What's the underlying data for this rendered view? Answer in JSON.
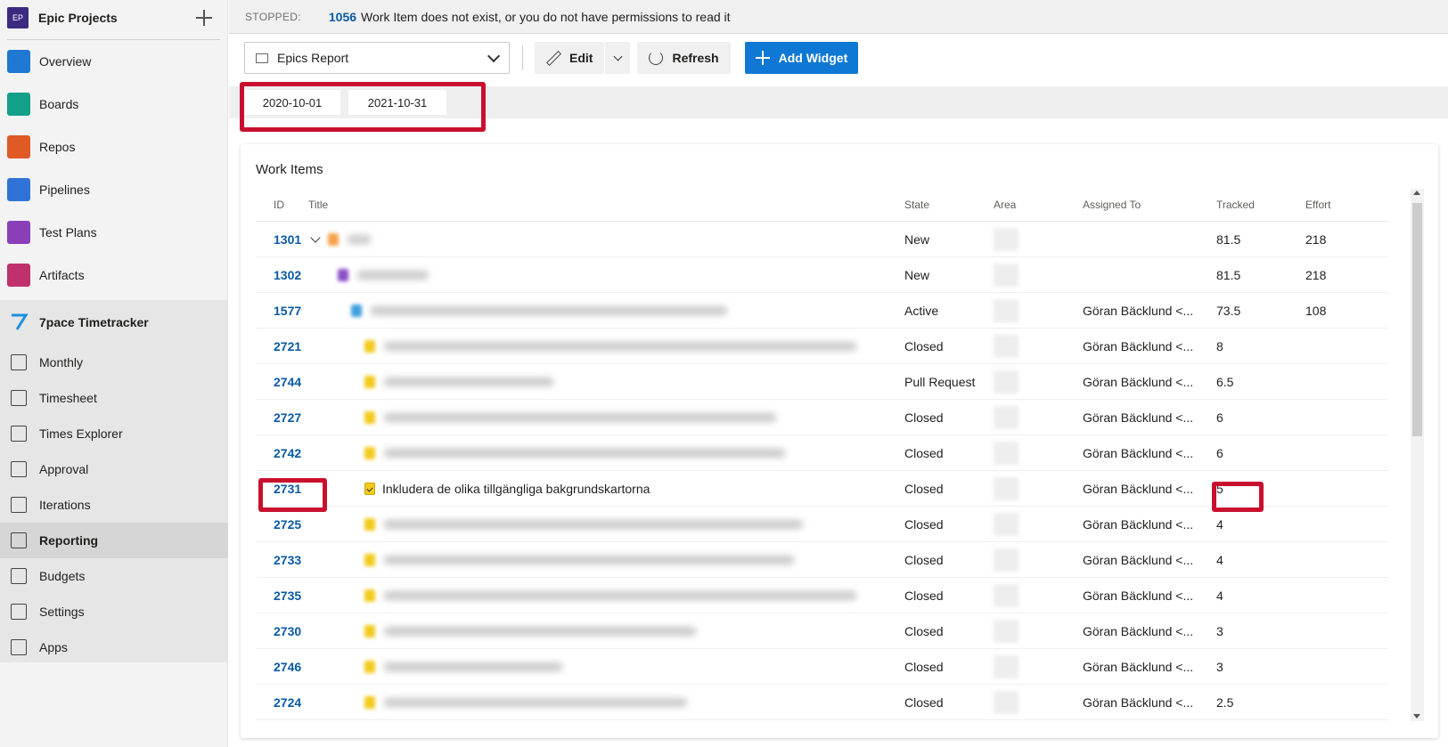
{
  "project": {
    "avatar": "EP",
    "name": "Epic Projects"
  },
  "nav": [
    {
      "label": "Overview",
      "icon": "overview-icon",
      "color": "#1f78d1"
    },
    {
      "label": "Boards",
      "icon": "boards-icon",
      "color": "#13a089"
    },
    {
      "label": "Repos",
      "icon": "repos-icon",
      "color": "#e05a26"
    },
    {
      "label": "Pipelines",
      "icon": "pipelines-icon",
      "color": "#2f73d6"
    },
    {
      "label": "Test Plans",
      "icon": "test-plans-icon",
      "color": "#8a3fb8"
    },
    {
      "label": "Artifacts",
      "icon": "artifacts-icon",
      "color": "#c0306c"
    }
  ],
  "tracker": {
    "title": "7pace Timetracker",
    "items": [
      {
        "label": "Monthly",
        "icon": "calendar-icon"
      },
      {
        "label": "Timesheet",
        "icon": "timesheet-icon"
      },
      {
        "label": "Times Explorer",
        "icon": "explorer-icon"
      },
      {
        "label": "Approval",
        "icon": "approval-icon"
      },
      {
        "label": "Iterations",
        "icon": "iterations-icon"
      },
      {
        "label": "Reporting",
        "icon": "reporting-icon",
        "active": true
      },
      {
        "label": "Budgets",
        "icon": "budgets-icon"
      },
      {
        "label": "Settings",
        "icon": "settings-icon"
      },
      {
        "label": "Apps",
        "icon": "apps-icon"
      }
    ]
  },
  "status": {
    "label": "STOPPED:",
    "id": "1056",
    "message": "Work Item does not exist, or you do not have permissions to read it"
  },
  "toolbar": {
    "dashboard": "Epics Report",
    "edit": "Edit",
    "refresh": "Refresh",
    "add_widget": "Add Widget"
  },
  "filters": {
    "start": "2020-10-01",
    "end": "2021-10-31"
  },
  "widget": {
    "title": "Work Items",
    "columns": {
      "id": "ID",
      "title": "Title",
      "state": "State",
      "area": "Area",
      "assigned": "Assigned To",
      "tracked": "Tracked",
      "effort": "Effort"
    },
    "rows": [
      {
        "id": "1301",
        "state": "New",
        "assigned": "",
        "tracked": "81.5",
        "effort": "218",
        "indent": 0,
        "expand": true,
        "icon_color": "#f7a24b",
        "title": ""
      },
      {
        "id": "1302",
        "state": "New",
        "assigned": "",
        "tracked": "81.5",
        "effort": "218",
        "indent": 1,
        "icon_color": "#8a4fc7",
        "title": ""
      },
      {
        "id": "1577",
        "state": "Active",
        "assigned": "Göran Bäcklund <...",
        "tracked": "73.5",
        "effort": "108",
        "indent": 2,
        "icon_color": "#3e9fe0",
        "title": ""
      },
      {
        "id": "2721",
        "state": "Closed",
        "assigned": "Göran Bäcklund <...",
        "tracked": "8",
        "effort": "",
        "indent": 3,
        "icon_color": "#f2cb1d",
        "title": ""
      },
      {
        "id": "2744",
        "state": "Pull Request",
        "assigned": "Göran Bäcklund <...",
        "tracked": "6.5",
        "effort": "",
        "indent": 3,
        "icon_color": "#f2cb1d",
        "title": ""
      },
      {
        "id": "2727",
        "state": "Closed",
        "assigned": "Göran Bäcklund <...",
        "tracked": "6",
        "effort": "",
        "indent": 3,
        "icon_color": "#f2cb1d",
        "title": ""
      },
      {
        "id": "2742",
        "state": "Closed",
        "assigned": "Göran Bäcklund <...",
        "tracked": "6",
        "effort": "",
        "indent": 3,
        "icon_color": "#f2cb1d",
        "title": ""
      },
      {
        "id": "2731",
        "state": "Closed",
        "assigned": "Göran Bäcklund <...",
        "tracked": "5",
        "effort": "",
        "indent": 3,
        "icon_color": "#f2cb1d",
        "title": "Inkludera de olika tillgängliga bakgrundskartorna",
        "visible": true
      },
      {
        "id": "2725",
        "state": "Closed",
        "assigned": "Göran Bäcklund <...",
        "tracked": "4",
        "effort": "",
        "indent": 3,
        "icon_color": "#f2cb1d",
        "title": ""
      },
      {
        "id": "2733",
        "state": "Closed",
        "assigned": "Göran Bäcklund <...",
        "tracked": "4",
        "effort": "",
        "indent": 3,
        "icon_color": "#f2cb1d",
        "title": ""
      },
      {
        "id": "2735",
        "state": "Closed",
        "assigned": "Göran Bäcklund <...",
        "tracked": "4",
        "effort": "",
        "indent": 3,
        "icon_color": "#f2cb1d",
        "title": ""
      },
      {
        "id": "2730",
        "state": "Closed",
        "assigned": "Göran Bäcklund <...",
        "tracked": "3",
        "effort": "",
        "indent": 3,
        "icon_color": "#f2cb1d",
        "title": ""
      },
      {
        "id": "2746",
        "state": "Closed",
        "assigned": "Göran Bäcklund <...",
        "tracked": "3",
        "effort": "",
        "indent": 3,
        "icon_color": "#f2cb1d",
        "title": ""
      },
      {
        "id": "2724",
        "state": "Closed",
        "assigned": "Göran Bäcklund <...",
        "tracked": "2.5",
        "effort": "",
        "indent": 3,
        "icon_color": "#f2cb1d",
        "title": ""
      }
    ]
  }
}
